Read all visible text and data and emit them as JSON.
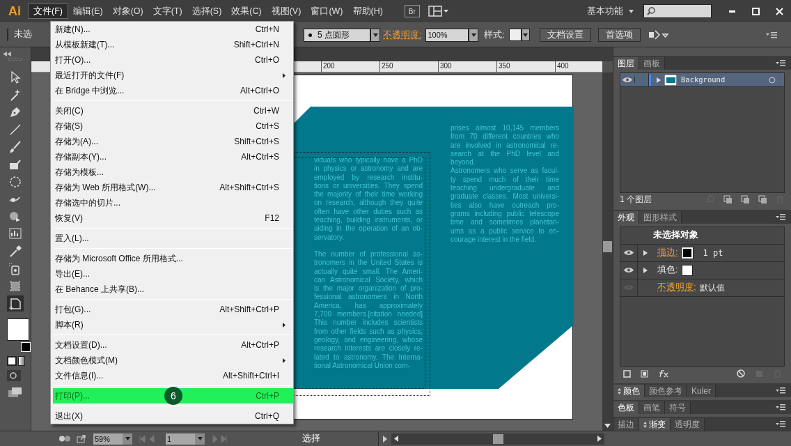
{
  "menubar": {
    "logo": "Ai",
    "menus": [
      {
        "label": "文件(F)",
        "selected": true
      },
      {
        "label": "编辑(E)",
        "selected": false
      },
      {
        "label": "对象(O)",
        "selected": false
      },
      {
        "label": "文字(T)",
        "selected": false
      },
      {
        "label": "选择(S)",
        "selected": false
      },
      {
        "label": "效果(C)",
        "selected": false
      },
      {
        "label": "视图(V)",
        "selected": false
      },
      {
        "label": "窗口(W)",
        "selected": false
      },
      {
        "label": "帮助(H)",
        "selected": false
      }
    ],
    "bridge_button": "Br",
    "workspace": "基本功能"
  },
  "control_bar": {
    "selection": "未选",
    "brush": "5 点圆形",
    "opacity_label": "不透明度:",
    "opacity": "100%",
    "style_label": "样式:",
    "buttons": [
      "文档设置",
      "首选项"
    ]
  },
  "ruler": {
    "ticks": [
      "200",
      "250",
      "300",
      "350",
      "400"
    ]
  },
  "document": {
    "columns": [
      {
        "paragraphs": [
          {
            "lines": [
              "viduals who typically have a PhD",
              "in physics or astronomy and are",
              "employed by research institu-",
              "tions or universities. They spend",
              "the majority of their time working",
              "on research, although they quite",
              "often have other duties such as",
              "teaching, building instruments, or",
              "aiding in the operation of an ob-",
              "servatory."
            ]
          },
          {
            "lines": [
              "The number of professional as-",
              "tronomers in the United States is",
              "actually quite small. The Ameri-",
              "can Astronomical Society, which",
              "is the major organization of pro-",
              "fessional astronomers in North",
              "America, has approximately",
              "7,700 members.[citation needed]",
              "This number includes scientists",
              "from other fields such as physics,",
              "geology, and engineering, whose",
              "research interests are closely re-",
              "lated to astronomy. The Interna-",
              "tional Astronomical Union com-"
            ]
          }
        ]
      },
      {
        "paragraphs": [
          {
            "lines": [
              "prises almost 10,145 members",
              "from 70 different countries who",
              "are involved in astronomical re-",
              "search at the PhD level and",
              "beyond."
            ]
          },
          {
            "lines": [
              "Astronomers who serve as facul-",
              "ty spend much of their time",
              "teaching undergraduate and",
              "graduate classes. Most universi-",
              "ties also have outreach pro-",
              "grams including public telescope",
              "time and sometimes planetari-",
              "ums as a public service to en-",
              "courage interest in the field."
            ]
          }
        ]
      }
    ]
  },
  "file_menu": {
    "groups": [
      [
        {
          "label": "新建(N)...",
          "shortcut": "Ctrl+N",
          "submenu": false,
          "highlighted": false
        },
        {
          "label": "从模板新建(T)...",
          "shortcut": "Shift+Ctrl+N",
          "submenu": false,
          "highlighted": false
        },
        {
          "label": "打开(O)...",
          "shortcut": "Ctrl+O",
          "submenu": false,
          "highlighted": false
        },
        {
          "label": "最近打开的文件(F)",
          "submenu": true,
          "highlighted": false
        },
        {
          "label": "在 Bridge 中浏览...",
          "shortcut": "Alt+Ctrl+O",
          "submenu": false,
          "highlighted": false
        }
      ],
      [
        {
          "label": "关闭(C)",
          "shortcut": "Ctrl+W",
          "submenu": false,
          "highlighted": false
        },
        {
          "label": "存储(S)",
          "shortcut": "Ctrl+S",
          "submenu": false,
          "highlighted": false
        },
        {
          "label": "存储为(A)...",
          "shortcut": "Shift+Ctrl+S",
          "submenu": false,
          "highlighted": false
        },
        {
          "label": "存储副本(Y)...",
          "shortcut": "Alt+Ctrl+S",
          "submenu": false,
          "highlighted": false
        },
        {
          "label": "存储为模板...",
          "submenu": false,
          "highlighted": false
        },
        {
          "label": "存储为 Web 所用格式(W)...",
          "shortcut": "Alt+Shift+Ctrl+S",
          "submenu": false,
          "highlighted": false
        },
        {
          "label": "存储选中的切片...",
          "submenu": false,
          "highlighted": false
        },
        {
          "label": "恢复(V)",
          "shortcut": "F12",
          "submenu": false,
          "highlighted": false
        }
      ],
      [
        {
          "label": "置入(L)...",
          "submenu": false,
          "highlighted": false
        }
      ],
      [
        {
          "label": "存储为 Microsoft Office 所用格式...",
          "submenu": false,
          "highlighted": false
        },
        {
          "label": "导出(E)...",
          "submenu": false,
          "highlighted": false
        },
        {
          "label": "在 Behance 上共享(B)...",
          "submenu": false,
          "highlighted": false
        }
      ],
      [
        {
          "label": "打包(G)...",
          "shortcut": "Alt+Shift+Ctrl+P",
          "submenu": false,
          "highlighted": false
        },
        {
          "label": "脚本(R)",
          "submenu": true,
          "highlighted": false
        }
      ],
      [
        {
          "label": "文档设置(D)...",
          "shortcut": "Alt+Ctrl+P",
          "submenu": false,
          "highlighted": false
        },
        {
          "label": "文档颜色模式(M)",
          "submenu": true,
          "highlighted": false
        },
        {
          "label": "文件信息(I)...",
          "shortcut": "Alt+Shift+Ctrl+I",
          "submenu": false,
          "highlighted": false
        }
      ],
      [
        {
          "label": "打印(P)...",
          "shortcut": "Ctrl+P",
          "submenu": false,
          "highlighted": true
        }
      ],
      [
        {
          "label": "退出(X)",
          "shortcut": "Ctrl+Q",
          "submenu": false,
          "highlighted": false
        }
      ]
    ],
    "step_badge": "6"
  },
  "layers_panel": {
    "tabs": [
      {
        "label": "图层",
        "selected": true
      },
      {
        "label": "画板",
        "selected": false
      }
    ],
    "layers": [
      {
        "name": "Background",
        "visible": true
      }
    ],
    "footer": "1 个图层"
  },
  "appearance_panel": {
    "tabs": [
      {
        "label": "外观",
        "selected": true
      },
      {
        "label": "图形样式",
        "selected": false
      }
    ],
    "title": "未选择对象",
    "rows": [
      {
        "kind": "stroke",
        "label": "描边:",
        "visible": true,
        "value": "1 pt"
      },
      {
        "kind": "fill",
        "label": "填色:",
        "visible": true
      },
      {
        "kind": "opacity",
        "label": "不透明度:",
        "visible": false,
        "value": "默认值"
      }
    ]
  },
  "collapsed_panels": [
    {
      "tabs": [
        {
          "label": "颜色",
          "selected": true
        },
        {
          "label": "颜色参考",
          "selected": false
        },
        {
          "label": "Kuler",
          "selected": false
        }
      ]
    },
    {
      "tabs": [
        {
          "label": "色板",
          "selected": true
        },
        {
          "label": "画笔",
          "selected": false
        },
        {
          "label": "符号",
          "selected": false
        }
      ]
    },
    {
      "tabs": [
        {
          "label": "描边",
          "selected": false
        },
        {
          "label": "渐变",
          "selected": true
        },
        {
          "label": "透明度",
          "selected": false
        }
      ]
    }
  ],
  "status_bar": {
    "zoom": "59%",
    "artboard": "1",
    "tool": "选择"
  }
}
